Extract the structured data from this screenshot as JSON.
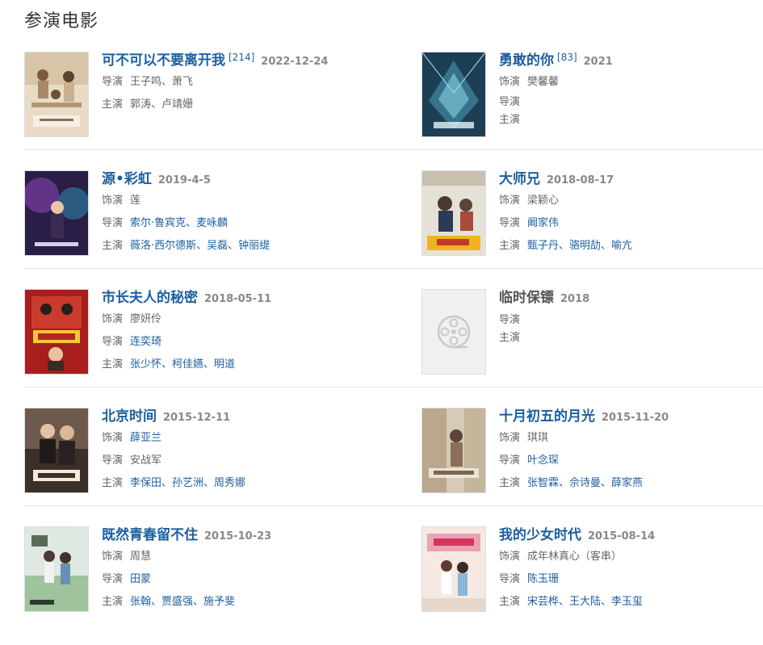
{
  "section_title": "参演电影",
  "labels": {
    "role": "饰演",
    "director": "导演",
    "cast": "主演"
  },
  "movies": [
    {
      "title": "可不可以不要离开我",
      "ref": "[214]",
      "date": "2022-12-24",
      "role": "",
      "director": "王子鸣、萧飞",
      "cast": "郭涛、卢靖姗",
      "poster": "poster-1"
    },
    {
      "title": "勇敢的你",
      "ref": "[83]",
      "date": "2021",
      "role": "樊馨馨",
      "director": "",
      "cast": "",
      "poster": "poster-2"
    },
    {
      "title": "源•彩虹",
      "ref": "",
      "date": "2019-4-5",
      "role": "莲",
      "director": "索尔·鲁宾克、麦咏麟",
      "cast": "薇洛·西尔德斯、吴磊、钟丽缇",
      "poster": "poster-3"
    },
    {
      "title": "大师兄",
      "ref": "",
      "date": "2018-08-17",
      "role": "梁颖心",
      "director": "阚家伟",
      "cast": "甄子丹、骆明劼、喻亢",
      "poster": "poster-4"
    },
    {
      "title": "市长夫人的秘密",
      "ref": "",
      "date": "2018-05-11",
      "role": "廖妍伶",
      "director": "连奕琦",
      "cast": "张少怀、柯佳嬿、明道",
      "poster": "poster-5"
    },
    {
      "title": "临时保镖",
      "ref": "",
      "date": "2018",
      "role": "",
      "director": "",
      "cast": "",
      "poster": "placeholder"
    },
    {
      "title": "北京时间",
      "ref": "",
      "date": "2015-12-11",
      "role": "薛亚兰",
      "director": "安战军",
      "cast": "李保田、孙艺洲、周秀娜",
      "poster": "poster-7"
    },
    {
      "title": "十月初五的月光",
      "ref": "",
      "date": "2015-11-20",
      "role": "琪琪",
      "director": "叶念琛",
      "cast": "张智霖、佘诗曼、薛家燕",
      "poster": "poster-8"
    },
    {
      "title": "既然青春留不住",
      "ref": "",
      "date": "2015-10-23",
      "role": "周慧",
      "director": "田蒙",
      "cast": "张翰、贾盛强、施予斐",
      "poster": "poster-9"
    },
    {
      "title": "我的少女时代",
      "ref": "",
      "date": "2015-08-14",
      "role": "成年林真心（客串）",
      "director": "陈玉珊",
      "cast": "宋芸桦、王大陆、李玉玺",
      "poster": "poster-10"
    }
  ],
  "colors": {
    "link": "#1d5fa0",
    "muted": "#888888",
    "text": "#666666",
    "divider": "#e6e6e6"
  }
}
